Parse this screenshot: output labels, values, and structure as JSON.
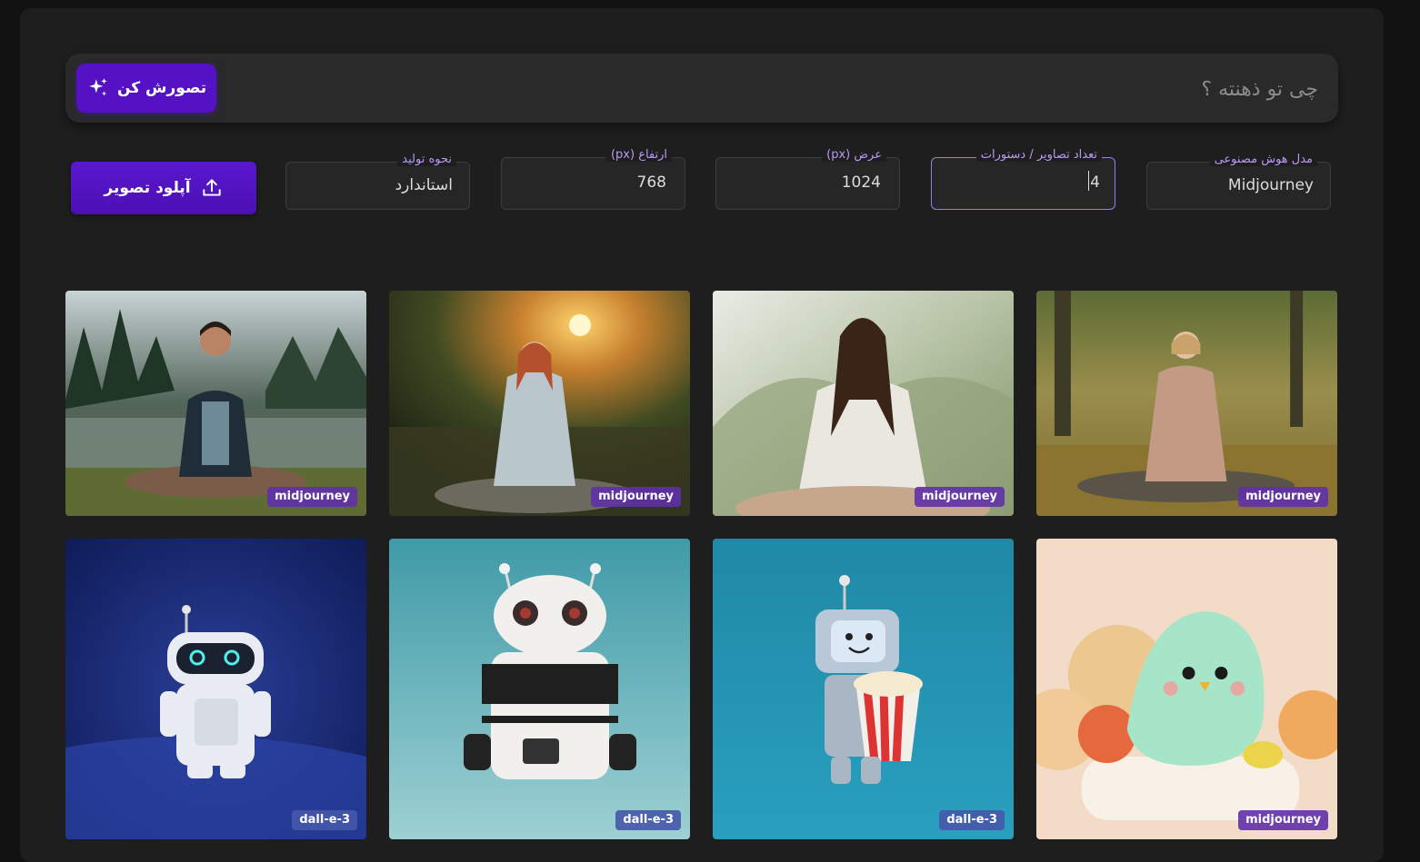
{
  "prompt": {
    "placeholder": "چی تو ذهنته ؟",
    "submit_label": "تصورش کن",
    "submit_icon": "sparkles-icon"
  },
  "settings": {
    "model": {
      "label": "مدل هوش مصنوعی",
      "value": "Midjourney"
    },
    "count": {
      "label": "تعداد تصاویر / دستورات",
      "value": "4"
    },
    "width": {
      "label": "عرض (px)",
      "value": "1024"
    },
    "height": {
      "label": "ارتفاع (px)",
      "value": "768"
    },
    "mode": {
      "label": "نحوه تولید",
      "value": "استاندارد"
    },
    "upload": {
      "label": "آپلود تصویر",
      "icon": "upload-icon"
    }
  },
  "gallery": [
    {
      "badge": "midjourney"
    },
    {
      "badge": "midjourney"
    },
    {
      "badge": "midjourney"
    },
    {
      "badge": "midjourney"
    },
    {
      "badge": "dall-e-3"
    },
    {
      "badge": "dall-e-3"
    },
    {
      "badge": "dall-e-3"
    },
    {
      "badge": "midjourney"
    }
  ],
  "colors": {
    "background": "#121212",
    "panel": "#1e1e1e",
    "accent": "#5412c4",
    "label": "#b89af7"
  }
}
